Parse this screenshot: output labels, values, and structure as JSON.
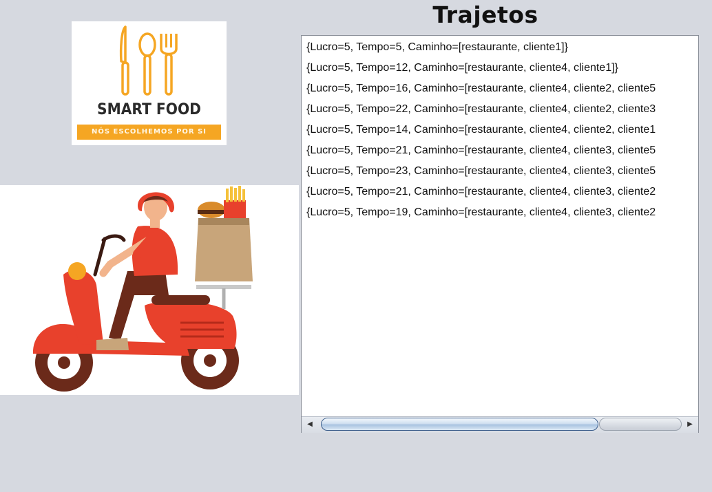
{
  "header": {
    "title": "Trajetos"
  },
  "logo": {
    "name": "SMART FOOD",
    "tagline": "NÓS ESCOLHEMOS POR SI",
    "accent_color": "#f5a623"
  },
  "illustration": {
    "description_icon": "delivery-scooter-icon"
  },
  "routes": [
    "{Lucro=5, Tempo=5, Caminho=[restaurante, cliente1]}",
    "{Lucro=5, Tempo=12, Caminho=[restaurante, cliente4, cliente1]}",
    "{Lucro=5, Tempo=16, Caminho=[restaurante, cliente4, cliente2, cliente5",
    "{Lucro=5, Tempo=22, Caminho=[restaurante, cliente4, cliente2, cliente3",
    "{Lucro=5, Tempo=14, Caminho=[restaurante, cliente4, cliente2, cliente1",
    "{Lucro=5, Tempo=21, Caminho=[restaurante, cliente4, cliente3, cliente5",
    "{Lucro=5, Tempo=23, Caminho=[restaurante, cliente4, cliente3, cliente5",
    "{Lucro=5, Tempo=21, Caminho=[restaurante, cliente4, cliente3, cliente2",
    "{Lucro=5, Tempo=19, Caminho=[restaurante, cliente4, cliente3, cliente2"
  ],
  "scrollbar": {
    "left_arrow_icon": "◀",
    "right_arrow_icon": "▶"
  },
  "colors": {
    "background": "#d6d9e0",
    "scooter_red": "#e8412c",
    "wheel_brown": "#6b2a1a"
  }
}
